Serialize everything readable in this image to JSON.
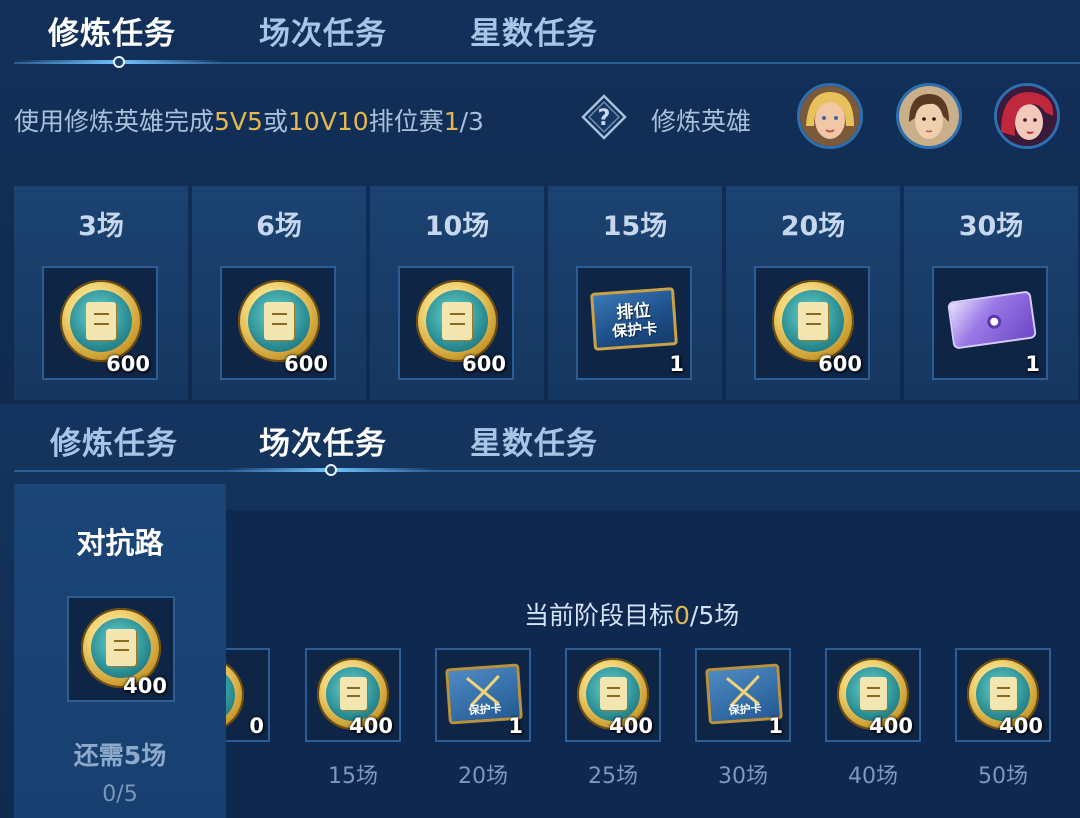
{
  "top_panel": {
    "tabs": [
      {
        "label": "修炼任务",
        "active": true
      },
      {
        "label": "场次任务",
        "active": false
      },
      {
        "label": "星数任务",
        "active": false
      }
    ],
    "task": {
      "prefix": "使用修炼英雄完成",
      "mode1": "5V5",
      "or": "或",
      "mode2": "10V10",
      "suffix": "排位赛",
      "progress_current": "1",
      "progress_total": "/3"
    },
    "help_icon": "question-mark-diamond-icon",
    "heroes_label": "修炼英雄",
    "heroes": [
      "hero-avatar-blonde",
      "hero-avatar-brown-hair",
      "hero-avatar-red-hair"
    ],
    "rewards": [
      {
        "title": "3场",
        "icon": "coin-scroll-icon",
        "count": "600"
      },
      {
        "title": "6场",
        "icon": "coin-scroll-icon",
        "count": "600"
      },
      {
        "title": "10场",
        "icon": "coin-scroll-icon",
        "count": "600"
      },
      {
        "title": "15场",
        "icon": "rank-protection-card-icon",
        "card_text_1": "排位",
        "card_text_2": "保护卡",
        "count": "1"
      },
      {
        "title": "20场",
        "icon": "coin-scroll-icon",
        "count": "600"
      },
      {
        "title": "30场",
        "icon": "purple-ticket-icon",
        "count": "1"
      }
    ]
  },
  "bottom_panel": {
    "tabs": [
      {
        "label": "修炼任务",
        "active": false
      },
      {
        "label": "场次任务",
        "active": true
      },
      {
        "label": "星数任务",
        "active": false
      }
    ],
    "side": {
      "title": "对抗路",
      "reward_count": "400",
      "need_text": "还需5场",
      "progress": "0/5"
    },
    "goal": {
      "prefix": "当前阶段目标",
      "current": "0",
      "suffix": "/5场"
    },
    "partial_count": "0",
    "milestones": [
      {
        "label": "15场",
        "icon": "coin-scroll-icon",
        "count": "400"
      },
      {
        "label": "20场",
        "icon": "guard-card-icon",
        "card_text": "保护卡",
        "count": "1"
      },
      {
        "label": "25场",
        "icon": "coin-scroll-icon",
        "count": "400"
      },
      {
        "label": "30场",
        "icon": "guard-card-icon",
        "card_text": "保护卡",
        "count": "1"
      },
      {
        "label": "40场",
        "icon": "coin-scroll-icon",
        "count": "400"
      },
      {
        "label": "50场",
        "icon": "coin-scroll-icon",
        "count": "400"
      }
    ]
  },
  "colors": {
    "background": "#10294b",
    "highlight": "#e4b84f",
    "tab_active": "#ffffff",
    "tab_inactive": "#a8c4e6",
    "border": "#2c5d94"
  }
}
